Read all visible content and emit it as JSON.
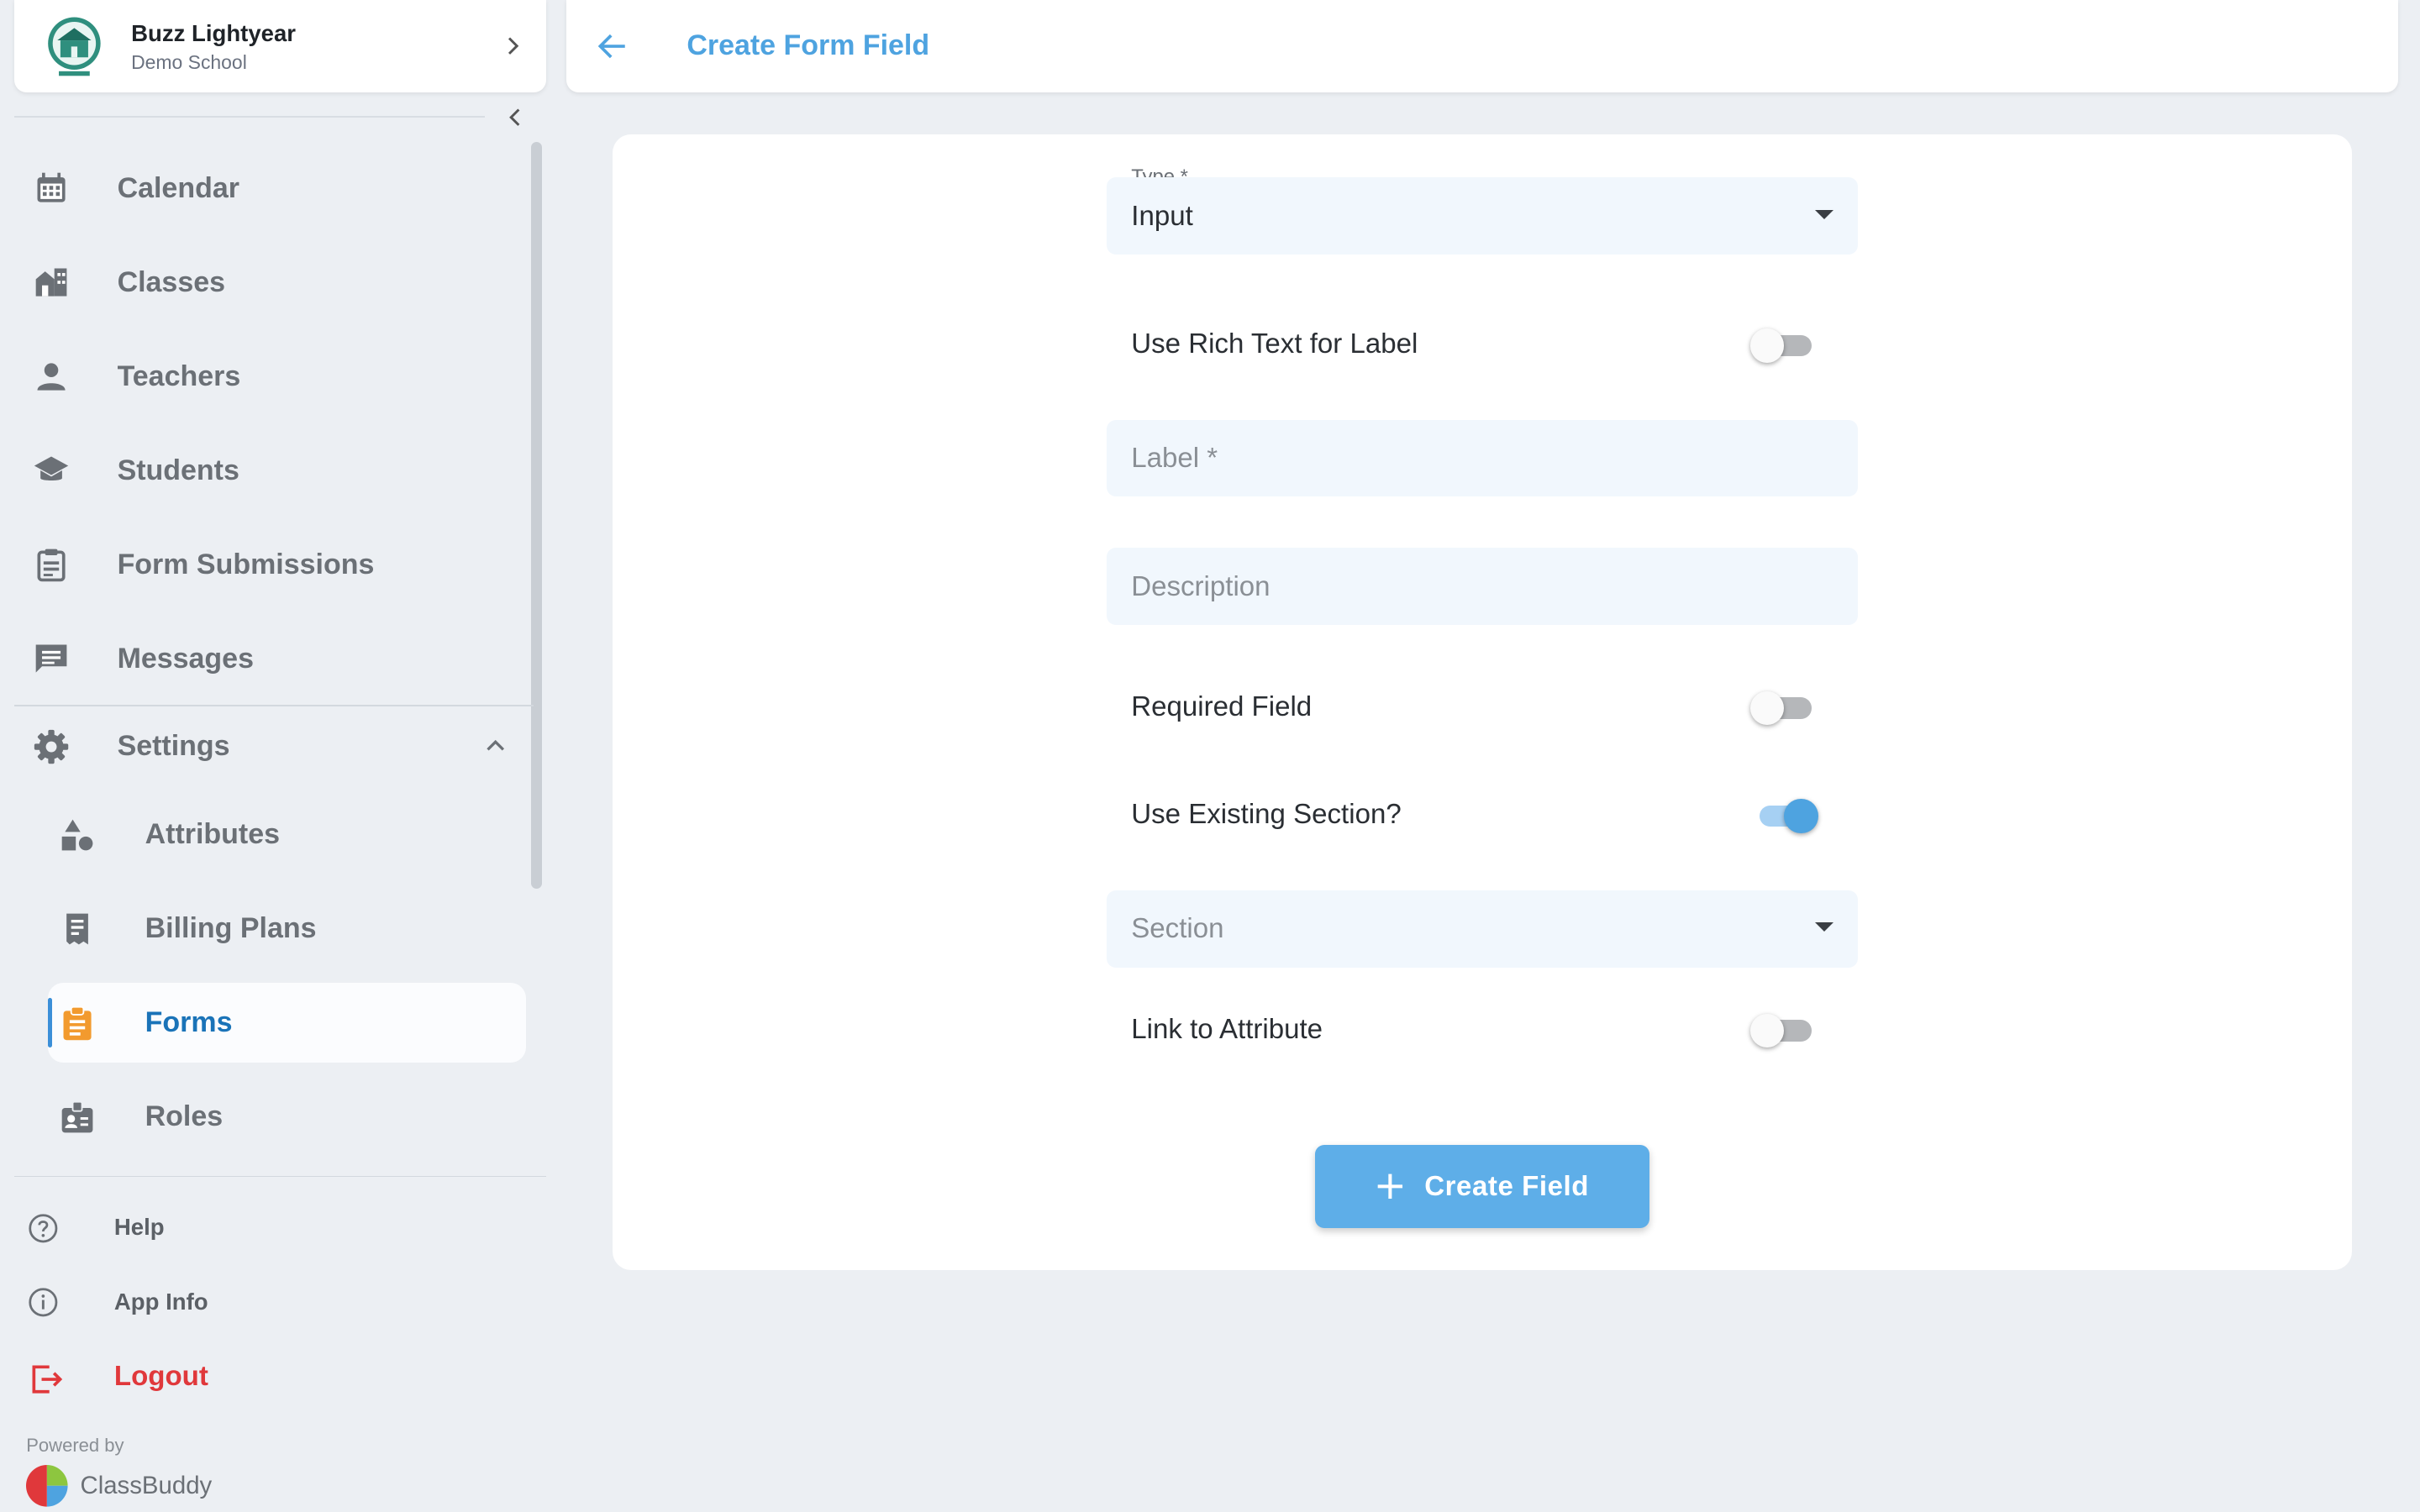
{
  "profile": {
    "name": "Buzz Lightyear",
    "school": "Demo School"
  },
  "nav": {
    "calendar": "Calendar",
    "classes": "Classes",
    "teachers": "Teachers",
    "students": "Students",
    "form_submissions": "Form Submissions",
    "messages": "Messages",
    "settings": "Settings",
    "attributes": "Attributes",
    "billing_plans": "Billing Plans",
    "forms": "Forms",
    "roles": "Roles",
    "active": "Forms"
  },
  "bottom": {
    "help": "Help",
    "app_info": "App Info",
    "logout": "Logout"
  },
  "footer": {
    "powered_by": "Powered by",
    "brand": "ClassBuddy"
  },
  "header": {
    "title": "Create Form Field"
  },
  "form": {
    "type_label": "Type *",
    "type_value": "Input",
    "rich_text_label": "Use Rich Text for Label",
    "rich_text_on": false,
    "label_placeholder": "Label *",
    "description_placeholder": "Description",
    "required_label": "Required Field",
    "required_on": false,
    "existing_section_label": "Use Existing Section?",
    "existing_section_on": true,
    "section_placeholder": "Section",
    "link_attribute_label": "Link to Attribute",
    "link_attribute_on": false,
    "submit_label": "Create Field"
  },
  "colors": {
    "accent": "#4ea3e0",
    "active_nav": "#1a73b8",
    "logout": "#e0383b",
    "forms_icon": "#f29a2e"
  }
}
